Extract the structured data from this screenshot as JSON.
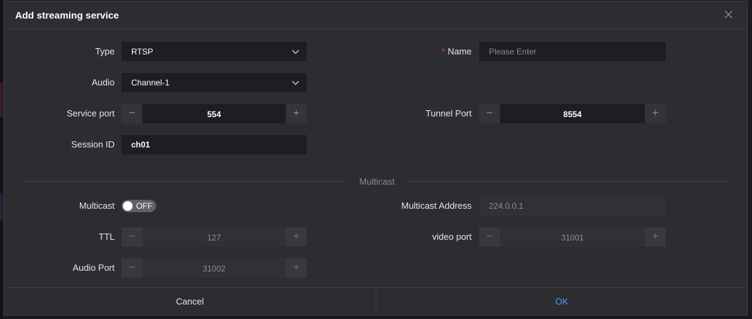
{
  "dialog": {
    "title": "Add streaming service",
    "close_icon": "close-icon"
  },
  "form": {
    "type": {
      "label": "Type",
      "value": "RTSP"
    },
    "name": {
      "label": "Name",
      "required_mark": "*",
      "placeholder": "Please Enter",
      "value": ""
    },
    "audio": {
      "label": "Audio",
      "value": "Channel-1"
    },
    "service_port": {
      "label": "Service port",
      "value": "554"
    },
    "tunnel_port": {
      "label": "Tunnel Port",
      "value": "8554"
    },
    "session_id": {
      "label": "Session ID",
      "value": "ch01"
    }
  },
  "multicast_section": {
    "heading": "Multicast",
    "multicast": {
      "label": "Multicast",
      "toggle_text": "OFF",
      "enabled": false
    },
    "multicast_address": {
      "label": "Multicast Address",
      "value": "224.0.0.1"
    },
    "ttl": {
      "label": "TTL",
      "value": "127"
    },
    "video_port": {
      "label": "video port",
      "value": "31001"
    },
    "audio_port": {
      "label": "Audio Port",
      "value": "31002"
    }
  },
  "stepper": {
    "minus": "−",
    "plus": "+"
  },
  "footer": {
    "cancel_label": "Cancel",
    "ok_label": "OK"
  },
  "colors": {
    "accent": "#4a9ef7",
    "required": "#e54545",
    "dialog_bg": "#2c2c31",
    "input_bg": "#1e1e22"
  }
}
